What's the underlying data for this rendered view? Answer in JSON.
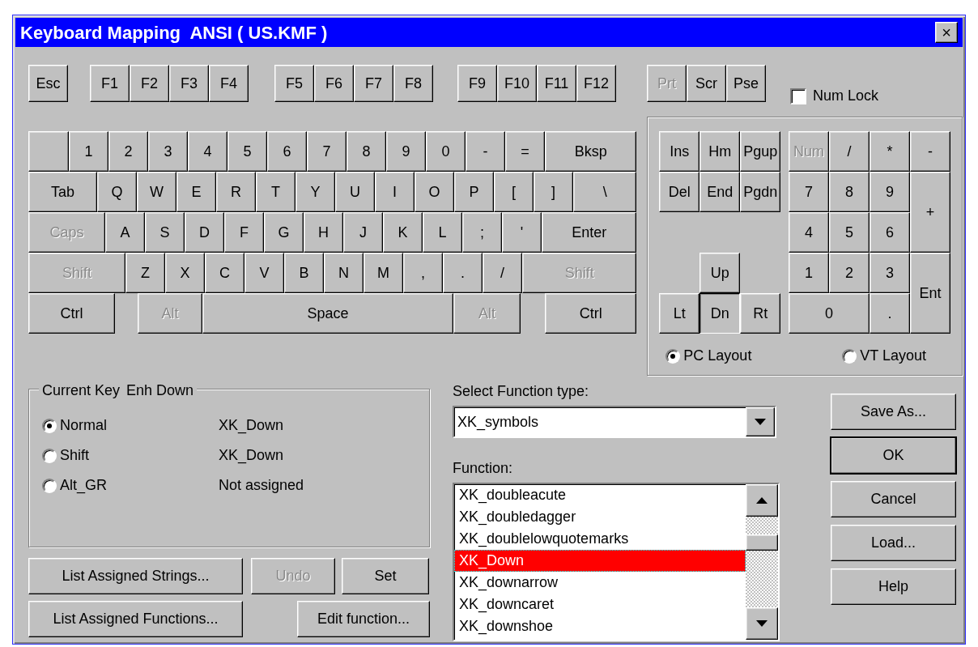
{
  "window": {
    "title": "Keyboard Mapping  ANSI ( US.KMF )",
    "close": "×"
  },
  "function_keys": [
    [
      {
        "label": "Esc",
        "disabled": false
      }
    ],
    [
      {
        "label": "F1",
        "disabled": false
      },
      {
        "label": "F2",
        "disabled": false
      },
      {
        "label": "F3",
        "disabled": false
      },
      {
        "label": "F4",
        "disabled": false
      }
    ],
    [
      {
        "label": "F5",
        "disabled": false
      },
      {
        "label": "F6",
        "disabled": false
      },
      {
        "label": "F7",
        "disabled": false
      },
      {
        "label": "F8",
        "disabled": false
      }
    ],
    [
      {
        "label": "F9",
        "disabled": false
      },
      {
        "label": "F10",
        "disabled": false
      },
      {
        "label": "F11",
        "disabled": false
      },
      {
        "label": "F12",
        "disabled": false
      }
    ],
    [
      {
        "label": "Prt",
        "disabled": true
      },
      {
        "label": "Scr",
        "disabled": false
      },
      {
        "label": "Pse",
        "disabled": false
      }
    ]
  ],
  "num_lock": {
    "label": "Num Lock",
    "checked": false
  },
  "main_keys": [
    [
      {
        "label": "1",
        "disabled": false
      },
      {
        "label": "2",
        "disabled": false
      },
      {
        "label": "3",
        "disabled": false
      },
      {
        "label": "4",
        "disabled": false
      },
      {
        "label": "5",
        "disabled": false
      },
      {
        "label": "6",
        "disabled": false
      },
      {
        "label": "7",
        "disabled": false
      },
      {
        "label": "8",
        "disabled": false
      },
      {
        "label": "9",
        "disabled": false
      },
      {
        "label": "0",
        "disabled": false
      },
      {
        "label": "-",
        "disabled": false
      },
      {
        "label": "=",
        "disabled": false
      },
      {
        "label": "Bksp",
        "disabled": false
      }
    ],
    [
      {
        "label": "Tab",
        "disabled": false
      },
      {
        "label": "Q",
        "disabled": false
      },
      {
        "label": "W",
        "disabled": false
      },
      {
        "label": "E",
        "disabled": false
      },
      {
        "label": "R",
        "disabled": false
      },
      {
        "label": "T",
        "disabled": false
      },
      {
        "label": "Y",
        "disabled": false
      },
      {
        "label": "U",
        "disabled": false
      },
      {
        "label": "I",
        "disabled": false
      },
      {
        "label": "O",
        "disabled": false
      },
      {
        "label": "P",
        "disabled": false
      },
      {
        "label": "[",
        "disabled": false
      },
      {
        "label": "]",
        "disabled": false
      },
      {
        "label": "\\",
        "disabled": false
      }
    ],
    [
      {
        "label": "Caps",
        "disabled": true
      },
      {
        "label": "A",
        "disabled": false
      },
      {
        "label": "S",
        "disabled": false
      },
      {
        "label": "D",
        "disabled": false
      },
      {
        "label": "F",
        "disabled": false
      },
      {
        "label": "G",
        "disabled": false
      },
      {
        "label": "H",
        "disabled": false
      },
      {
        "label": "J",
        "disabled": false
      },
      {
        "label": "K",
        "disabled": false
      },
      {
        "label": "L",
        "disabled": false
      },
      {
        "label": ";",
        "disabled": false
      },
      {
        "label": "'",
        "disabled": false
      },
      {
        "label": "Enter",
        "disabled": false
      }
    ],
    [
      {
        "label": "Shift",
        "disabled": true
      },
      {
        "label": "Z",
        "disabled": false
      },
      {
        "label": "X",
        "disabled": false
      },
      {
        "label": "C",
        "disabled": false
      },
      {
        "label": "V",
        "disabled": false
      },
      {
        "label": "B",
        "disabled": false
      },
      {
        "label": "N",
        "disabled": false
      },
      {
        "label": "M",
        "disabled": false
      },
      {
        "label": ",",
        "disabled": false
      },
      {
        "label": ".",
        "disabled": false
      },
      {
        "label": "/",
        "disabled": false
      },
      {
        "label": "Shift",
        "disabled": true
      }
    ],
    [
      {
        "label": "Ctrl",
        "disabled": false
      },
      {
        "label": "Alt",
        "disabled": true
      },
      {
        "label": "Space",
        "disabled": false
      },
      {
        "label": "Alt",
        "disabled": true
      },
      {
        "label": "Ctrl",
        "disabled": false
      }
    ]
  ],
  "nav_keys": [
    {
      "label": "Ins"
    },
    {
      "label": "Hm"
    },
    {
      "label": "Pgup"
    },
    {
      "label": "Del"
    },
    {
      "label": "End"
    },
    {
      "label": "Pgdn"
    }
  ],
  "arrow_keys": [
    {
      "label": "Up",
      "pressed": false
    },
    {
      "label": "Lt",
      "pressed": false
    },
    {
      "label": "Dn",
      "pressed": true
    },
    {
      "label": "Rt",
      "pressed": false
    }
  ],
  "numpad": [
    {
      "label": "Num",
      "disabled": true
    },
    {
      "label": "/",
      "disabled": false
    },
    {
      "label": "*",
      "disabled": false
    },
    {
      "label": "-",
      "disabled": false
    },
    {
      "label": "7",
      "disabled": false
    },
    {
      "label": "8",
      "disabled": false
    },
    {
      "label": "9",
      "disabled": false
    },
    {
      "label": "+",
      "disabled": false
    },
    {
      "label": "4",
      "disabled": false
    },
    {
      "label": "5",
      "disabled": false
    },
    {
      "label": "6",
      "disabled": false
    },
    {
      "label": "1",
      "disabled": false
    },
    {
      "label": "2",
      "disabled": false
    },
    {
      "label": "3",
      "disabled": false
    },
    {
      "label": "Ent",
      "disabled": false
    },
    {
      "label": "0",
      "disabled": false
    },
    {
      "label": ".",
      "disabled": false
    }
  ],
  "layout_options": [
    {
      "label": "PC Layout",
      "selected": true
    },
    {
      "label": "VT Layout",
      "selected": false
    }
  ],
  "current_key": {
    "title": "Current Key",
    "key_name": "Enh Down",
    "modes": [
      {
        "label": "Normal",
        "value": "XK_Down",
        "selected": true
      },
      {
        "label": "Shift",
        "value": "XK_Down",
        "selected": false
      },
      {
        "label": "Alt_GR",
        "value": "Not assigned",
        "selected": false
      }
    ]
  },
  "left_buttons": [
    [
      {
        "label": "List Assigned Strings...",
        "disabled": false
      },
      {
        "label": "Undo",
        "disabled": true
      },
      {
        "label": "Set",
        "disabled": false
      }
    ],
    [
      {
        "label": "List Assigned Functions...",
        "disabled": false
      },
      {
        "label": "Edit function...",
        "disabled": false
      }
    ]
  ],
  "function_type": {
    "label": "Select Function type:",
    "value": "XK_symbols"
  },
  "function_list": {
    "label": "Function:",
    "items": [
      {
        "text": "XK_doubleacute",
        "selected": false
      },
      {
        "text": "XK_doubledagger",
        "selected": false
      },
      {
        "text": "XK_doublelowquotemarks",
        "selected": false
      },
      {
        "text": "XK_Down",
        "selected": true
      },
      {
        "text": "XK_downarrow",
        "selected": false
      },
      {
        "text": "XK_downcaret",
        "selected": false
      },
      {
        "text": "XK_downshoe",
        "selected": false
      }
    ]
  },
  "dialog_buttons": [
    {
      "label": "Save As...",
      "default": false
    },
    {
      "label": "OK",
      "default": true
    },
    {
      "label": "Cancel",
      "default": false
    },
    {
      "label": "Load...",
      "default": false
    },
    {
      "label": "Help",
      "default": false
    }
  ]
}
